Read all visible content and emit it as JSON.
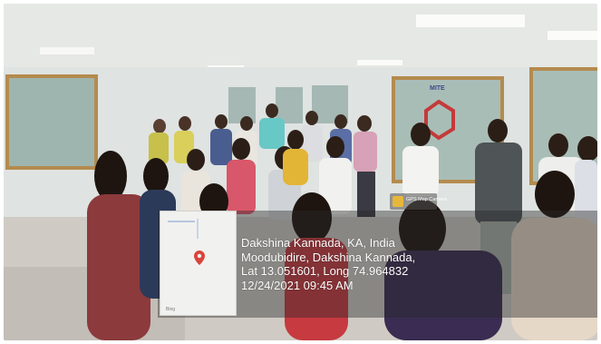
{
  "photo": {
    "description_icon": "group-photo"
  },
  "geotag": {
    "line1": "Dakshina Kannada, KA, India",
    "line2": "Moodubidire, Dakshina Kannada,",
    "line3": "Lat 13.051601, Long 74.964832",
    "line4": "12/24/2021 09:45 AM",
    "map_attribution": "Bing",
    "badge_label": "GPS Map Camera"
  },
  "signage": {
    "text": "MITE"
  },
  "colors": {
    "overlay": "#2828286b",
    "pin": "#d9443a",
    "badge_icon": "#e7b73a"
  }
}
